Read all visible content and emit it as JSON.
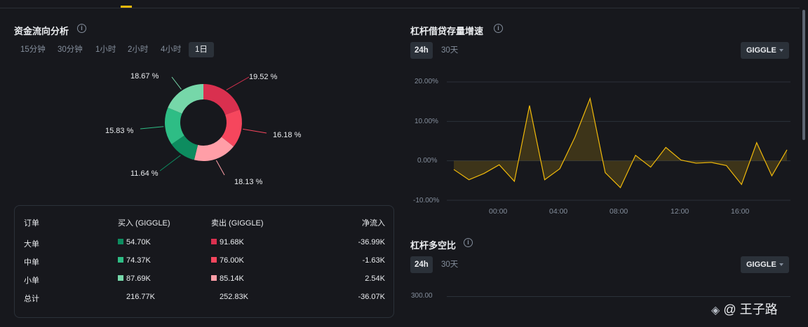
{
  "left_panel": {
    "title": "资金流向分析",
    "info_icon": "i",
    "timeframes": [
      "15分钟",
      "30分钟",
      "1小时",
      "2小时",
      "4小时",
      "1日"
    ],
    "active_timeframe": "1日",
    "donut": {
      "slices": [
        {
          "label": "19.52 %",
          "value": 19.52,
          "color": "#d9304f"
        },
        {
          "label": "16.18 %",
          "value": 16.18,
          "color": "#f6465d"
        },
        {
          "label": "18.13 %",
          "value": 18.13,
          "color": "#ff9ea7"
        },
        {
          "label": "11.64 %",
          "value": 11.64,
          "color": "#0d8c5f"
        },
        {
          "label": "15.83 %",
          "value": 15.83,
          "color": "#2ebd85"
        },
        {
          "label": "18.67 %",
          "value": 18.67,
          "color": "#76d7a9"
        }
      ]
    },
    "table": {
      "headers": {
        "order": "订单",
        "buy": "买入 (GIGGLE)",
        "sell": "卖出 (GIGGLE)",
        "net": "净流入"
      },
      "rows": [
        {
          "name": "大单",
          "buy": "54.70K",
          "sell": "91.68K",
          "net": "-36.99K",
          "buy_color": "#0d8c5f",
          "sell_color": "#d9304f"
        },
        {
          "name": "中单",
          "buy": "74.37K",
          "sell": "76.00K",
          "net": "-1.63K",
          "buy_color": "#2ebd85",
          "sell_color": "#f6465d"
        },
        {
          "name": "小单",
          "buy": "87.69K",
          "sell": "85.14K",
          "net": "2.54K",
          "buy_color": "#76d7a9",
          "sell_color": "#ff9ea7"
        },
        {
          "name": "总计",
          "buy": "216.77K",
          "sell": "252.83K",
          "net": "-36.07K"
        }
      ]
    }
  },
  "right_top": {
    "title": "杠杆借贷存量增速",
    "tabs": [
      "24h",
      "30天"
    ],
    "active_tab": "24h",
    "dropdown": "GIGGLE",
    "y_ticks": [
      "20.00%",
      "10.00%",
      "0.00%",
      "-10.00%"
    ],
    "x_ticks": [
      "00:00",
      "04:00",
      "08:00",
      "12:00",
      "16:00"
    ]
  },
  "right_bottom": {
    "title": "杠杆多空比",
    "tabs": [
      "24h",
      "30天"
    ],
    "active_tab": "24h",
    "dropdown": "GIGGLE",
    "y_ticks": [
      "300.00"
    ]
  },
  "watermark": "@ 王子路",
  "chart_data": {
    "type": "area",
    "x": [
      "-2",
      "-1.3",
      "-0.6",
      "0",
      "0.6",
      "1",
      "2",
      "2.5",
      "3.5",
      "4",
      "5",
      "6",
      "7",
      "8",
      "9",
      "10",
      "11",
      "12",
      "13",
      "14",
      "15",
      "16",
      "17",
      "18",
      "19"
    ],
    "values": [
      -2.2,
      -4.8,
      -3.2,
      -1.0,
      -5.2,
      14.0,
      -4.8,
      -2.0,
      6.0,
      15.8,
      -3.0,
      -6.8,
      1.4,
      -1.6,
      3.4,
      0.2,
      -0.6,
      -0.4,
      -1.2,
      -6.0,
      4.6,
      -3.8,
      2.8
    ],
    "ylim": [
      -10,
      20
    ],
    "y_ticks": [
      20,
      10,
      0,
      -10
    ],
    "x_tick_labels": [
      "00:00",
      "04:00",
      "08:00",
      "12:00",
      "16:00"
    ],
    "line_color": "#f0b90b"
  }
}
